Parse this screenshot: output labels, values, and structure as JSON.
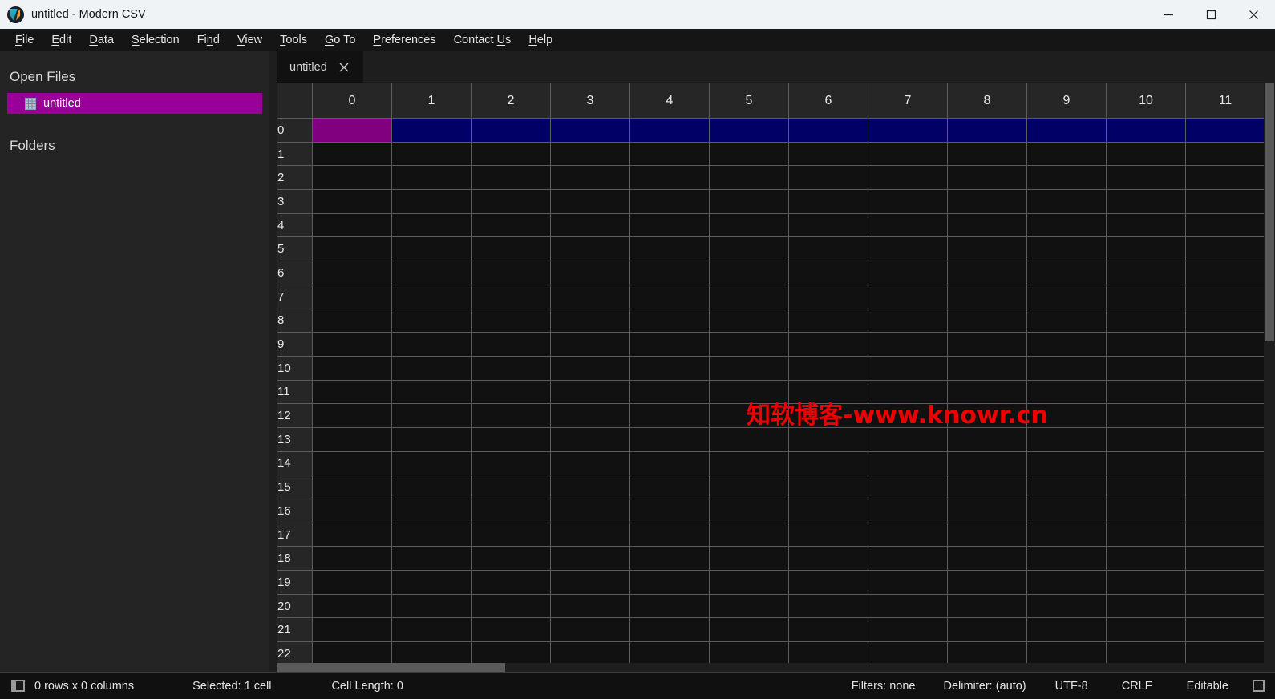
{
  "window": {
    "title": "untitled - Modern CSV",
    "logo_icon": "modern-csv-logo-icon",
    "minimize_icon": "minimize-icon",
    "maximize_icon": "maximize-icon",
    "close_icon": "close-icon"
  },
  "menubar": {
    "items": [
      {
        "label": "File",
        "mnemonic": "F"
      },
      {
        "label": "Edit",
        "mnemonic": "E"
      },
      {
        "label": "Data",
        "mnemonic": "D"
      },
      {
        "label": "Selection",
        "mnemonic": "S"
      },
      {
        "label": "Find",
        "mnemonic": "n"
      },
      {
        "label": "View",
        "mnemonic": "V"
      },
      {
        "label": "Tools",
        "mnemonic": "T"
      },
      {
        "label": "Go To",
        "mnemonic": "G"
      },
      {
        "label": "Preferences",
        "mnemonic": "P"
      },
      {
        "label": "Contact Us",
        "mnemonic": "U"
      },
      {
        "label": "Help",
        "mnemonic": "H"
      }
    ]
  },
  "sidebar": {
    "open_files_title": "Open Files",
    "folders_title": "Folders",
    "open_files": [
      {
        "label": "untitled",
        "icon": "spreadsheet-icon",
        "selected": true
      }
    ]
  },
  "tabs": [
    {
      "label": "untitled",
      "active": true,
      "close_icon": "close-icon"
    }
  ],
  "grid": {
    "column_headers": [
      "0",
      "1",
      "2",
      "3",
      "4",
      "5",
      "6",
      "7",
      "8",
      "9",
      "10",
      "11"
    ],
    "row_headers": [
      "0",
      "1",
      "2",
      "3",
      "4",
      "5",
      "6",
      "7",
      "8",
      "9",
      "10",
      "11",
      "12",
      "13",
      "14",
      "15",
      "16",
      "17",
      "18",
      "19",
      "20",
      "21",
      "22"
    ],
    "cells": [],
    "selection": {
      "active_cell": {
        "row": 0,
        "col": 0
      },
      "selected_row": 0,
      "active_cell_color": "#800080",
      "selected_row_color": "#000066"
    },
    "vertical_scrollbar": {
      "name": "vertical-scrollbar"
    },
    "horizontal_scrollbar": {
      "name": "horizontal-scrollbar"
    }
  },
  "watermark": {
    "text": "知软博客-www.knowr.cn",
    "color": "#ee0000"
  },
  "statusbar": {
    "left": [
      {
        "name": "grid-mode-icon",
        "label": ""
      },
      {
        "name": "dimensions",
        "label": "0 rows x 0 columns"
      },
      {
        "name": "selection-count",
        "label": "Selected: 1 cell"
      },
      {
        "name": "cell-length",
        "label": "Cell Length: 0"
      }
    ],
    "right": [
      {
        "name": "filters",
        "label": "Filters: none"
      },
      {
        "name": "delimiter",
        "label": "Delimiter: (auto)"
      },
      {
        "name": "encoding",
        "label": "UTF-8"
      },
      {
        "name": "line-ending",
        "label": "CRLF"
      },
      {
        "name": "edit-mode",
        "label": "Editable"
      },
      {
        "name": "resize-grip-icon",
        "label": ""
      }
    ]
  }
}
